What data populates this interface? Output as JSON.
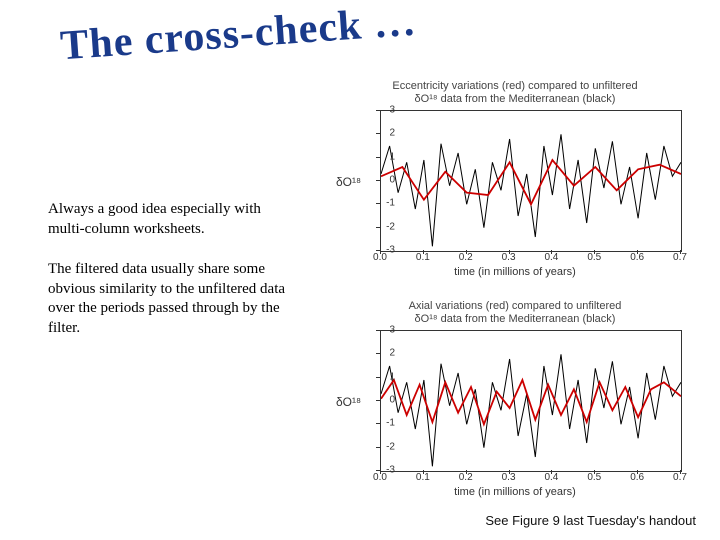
{
  "title": "The cross-check …",
  "paragraphs": {
    "p1": "Always a good idea especially with multi-column worksheets.",
    "p2": "The filtered data usually share some obvious similarity to the unfiltered data over the periods passed through by the filter."
  },
  "footer": "See Figure 9 last Tuesday's handout",
  "chart_data": [
    {
      "type": "line",
      "title_line1": "Eccentricity variations (red) compared to unfiltered",
      "title_line2": "δO¹⁸ data from the Mediterranean (black)",
      "xlabel": "time (in millions of years)",
      "ylabel": "δO¹⁸",
      "xlim": [
        0.0,
        0.7
      ],
      "ylim": [
        -3,
        3
      ],
      "xticks": [
        0.0,
        0.1,
        0.2,
        0.3,
        0.4,
        0.5,
        0.6,
        0.7
      ],
      "yticks": [
        -3,
        -2,
        -1,
        0,
        1,
        2,
        3
      ],
      "series": [
        {
          "name": "unfiltered δO¹⁸",
          "color": "#000000",
          "x": [
            0.0,
            0.02,
            0.04,
            0.06,
            0.08,
            0.1,
            0.12,
            0.14,
            0.16,
            0.18,
            0.2,
            0.22,
            0.24,
            0.26,
            0.28,
            0.3,
            0.32,
            0.34,
            0.36,
            0.38,
            0.4,
            0.42,
            0.44,
            0.46,
            0.48,
            0.5,
            0.52,
            0.54,
            0.56,
            0.58,
            0.6,
            0.62,
            0.64,
            0.66,
            0.68,
            0.7
          ],
          "values": [
            0.3,
            1.5,
            -0.5,
            0.8,
            -1.2,
            0.9,
            -2.8,
            1.6,
            -0.2,
            1.2,
            -1.0,
            0.5,
            -2.0,
            0.8,
            -0.4,
            1.8,
            -1.5,
            0.3,
            -2.4,
            1.5,
            -0.6,
            2.0,
            -1.2,
            0.9,
            -1.8,
            1.4,
            -0.3,
            1.7,
            -1.0,
            0.6,
            -1.6,
            1.2,
            -0.8,
            1.5,
            0.2,
            0.8
          ]
        },
        {
          "name": "eccentricity (filtered)",
          "color": "#cc0000",
          "x": [
            0.0,
            0.05,
            0.1,
            0.15,
            0.2,
            0.25,
            0.3,
            0.35,
            0.4,
            0.45,
            0.5,
            0.55,
            0.6,
            0.65,
            0.7
          ],
          "values": [
            0.2,
            0.6,
            -0.8,
            0.4,
            -0.5,
            -0.6,
            0.8,
            -1.0,
            0.9,
            -0.2,
            0.6,
            -0.4,
            0.5,
            0.7,
            0.3
          ]
        }
      ]
    },
    {
      "type": "line",
      "title_line1": "Axial variations (red) compared to unfiltered",
      "title_line2": "δO¹⁸ data from the Mediterranean (black)",
      "xlabel": "time (in millions of years)",
      "ylabel": "δO¹⁸",
      "xlim": [
        0.0,
        0.7
      ],
      "ylim": [
        -3,
        3
      ],
      "xticks": [
        0.0,
        0.1,
        0.2,
        0.3,
        0.4,
        0.5,
        0.6,
        0.7
      ],
      "yticks": [
        -3,
        -2,
        -1,
        0,
        1,
        2,
        3
      ],
      "series": [
        {
          "name": "unfiltered δO¹⁸",
          "color": "#000000",
          "x": [
            0.0,
            0.02,
            0.04,
            0.06,
            0.08,
            0.1,
            0.12,
            0.14,
            0.16,
            0.18,
            0.2,
            0.22,
            0.24,
            0.26,
            0.28,
            0.3,
            0.32,
            0.34,
            0.36,
            0.38,
            0.4,
            0.42,
            0.44,
            0.46,
            0.48,
            0.5,
            0.52,
            0.54,
            0.56,
            0.58,
            0.6,
            0.62,
            0.64,
            0.66,
            0.68,
            0.7
          ],
          "values": [
            0.3,
            1.5,
            -0.5,
            0.8,
            -1.2,
            0.9,
            -2.8,
            1.6,
            -0.2,
            1.2,
            -1.0,
            0.5,
            -2.0,
            0.8,
            -0.4,
            1.8,
            -1.5,
            0.3,
            -2.4,
            1.5,
            -0.6,
            2.0,
            -1.2,
            0.9,
            -1.8,
            1.4,
            -0.3,
            1.7,
            -1.0,
            0.6,
            -1.6,
            1.2,
            -0.8,
            1.5,
            0.2,
            0.8
          ]
        },
        {
          "name": "axial (filtered)",
          "color": "#cc0000",
          "x": [
            0.0,
            0.03,
            0.06,
            0.09,
            0.12,
            0.15,
            0.18,
            0.21,
            0.24,
            0.27,
            0.3,
            0.33,
            0.36,
            0.39,
            0.42,
            0.45,
            0.48,
            0.51,
            0.54,
            0.57,
            0.6,
            0.63,
            0.66,
            0.7
          ],
          "values": [
            0.1,
            0.9,
            -0.6,
            0.7,
            -0.9,
            0.8,
            -0.5,
            0.6,
            -1.0,
            0.4,
            -0.3,
            0.9,
            -0.8,
            0.7,
            -0.6,
            0.5,
            -0.9,
            0.8,
            -0.4,
            0.6,
            -0.7,
            0.5,
            0.8,
            0.2
          ]
        }
      ]
    }
  ]
}
